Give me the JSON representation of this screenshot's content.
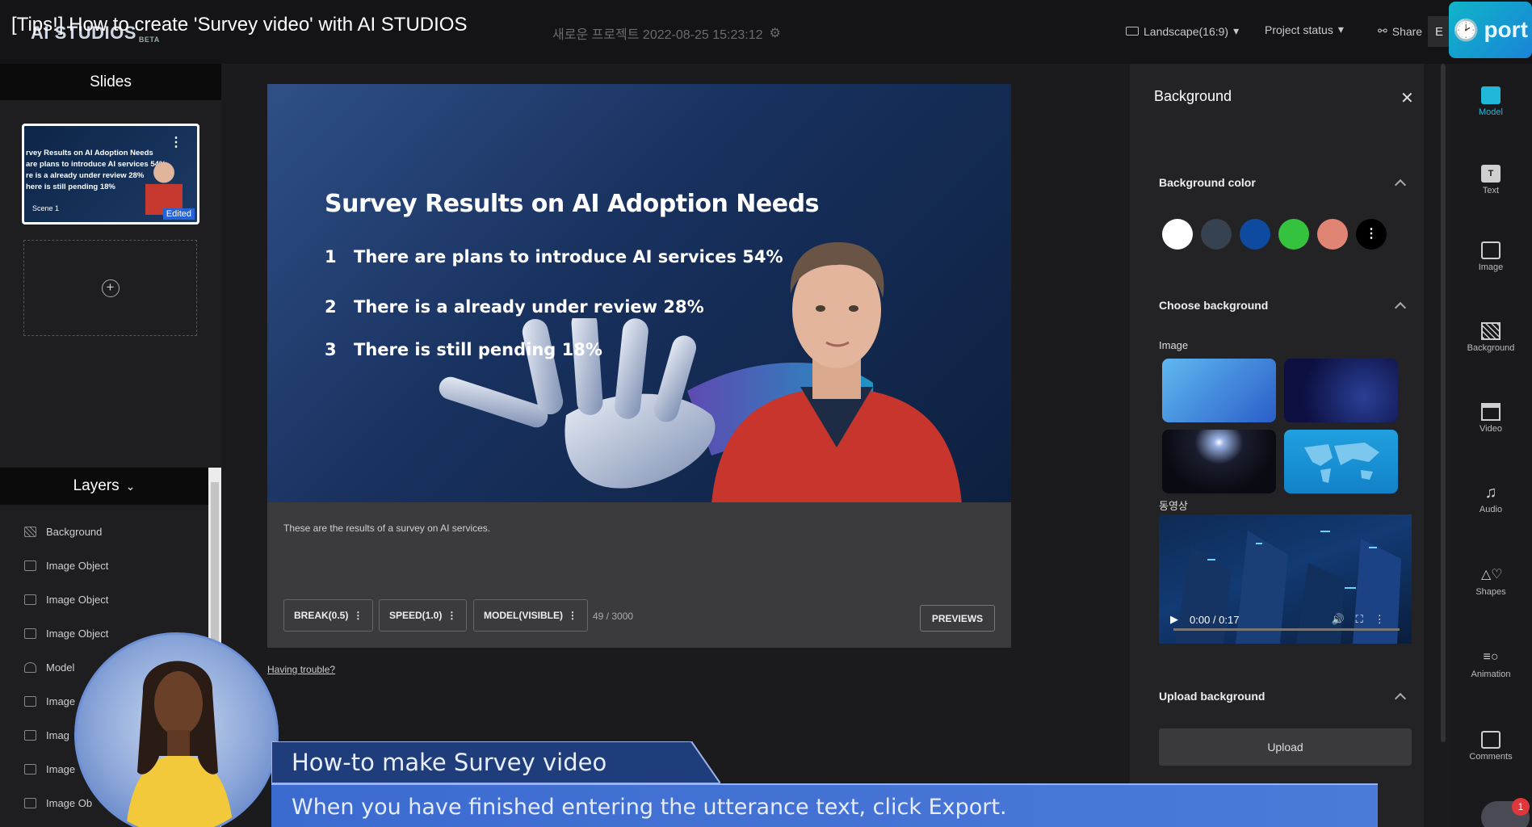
{
  "video_title": "[Tips!] How to create 'Survey video' with AI STUDIOS",
  "app": {
    "logo": "AI STUDIOS",
    "beta": "BETA"
  },
  "project": {
    "name": "새로운 프로젝트 2022-08-25 15:23:12"
  },
  "topbar": {
    "aspect": "Landscape(16:9)",
    "status": "Project status",
    "share": "Share",
    "e_button": "E",
    "export_label": "port"
  },
  "slides": {
    "header": "Slides",
    "thumb_lines": [
      "rvey Results on AI Adoption Needs",
      "are plans to introduce AI services 54%",
      "re is a already under review 28%",
      "here is still pending 18%"
    ],
    "scene_label": "Scene 1",
    "edited_badge": "Edited"
  },
  "layers": {
    "header": "Layers",
    "items": [
      "Background",
      "Image Object",
      "Image Object",
      "Image Object",
      "Model",
      "Image",
      "Imag",
      "Image",
      "Image Ob"
    ]
  },
  "canvas": {
    "title": "Survey Results on AI Adoption Needs",
    "rows": [
      {
        "num": "1",
        "text": "There are plans to introduce AI services 54%"
      },
      {
        "num": "2",
        "text": "There is a already under review 28%"
      },
      {
        "num": "3",
        "text": "There is still pending 18%"
      }
    ]
  },
  "script": {
    "text": "These are the results of a survey on AI services.",
    "break_chip": "BREAK(0.5)",
    "speed_chip": "SPEED(1.0)",
    "model_chip": "MODEL(VISIBLE)",
    "counter": "49 / 3000",
    "previews": "PREVIEWS",
    "trouble": "Having trouble?"
  },
  "background_panel": {
    "title": "Background",
    "color_section": "Background color",
    "swatches": [
      "#ffffff",
      "#36424f",
      "#0f4aa1",
      "#35c23e",
      "#e08473",
      "#000000"
    ],
    "choose_section": "Choose background",
    "image_label": "Image",
    "video_label": "동영상",
    "video_time": "0:00 / 0:17",
    "upload_section": "Upload background",
    "upload_button": "Upload"
  },
  "tools": [
    "Model",
    "Text",
    "Image",
    "Background",
    "Video",
    "Audio",
    "Shapes",
    "Animation",
    "Comments"
  ],
  "captions": {
    "line1": "How-to make Survey video",
    "line2": "When you have finished entering the utterance text, click Export."
  },
  "notification_count": "1",
  "colors": {
    "accent": "#1fb8d8",
    "caption": "#3c6bd0"
  }
}
